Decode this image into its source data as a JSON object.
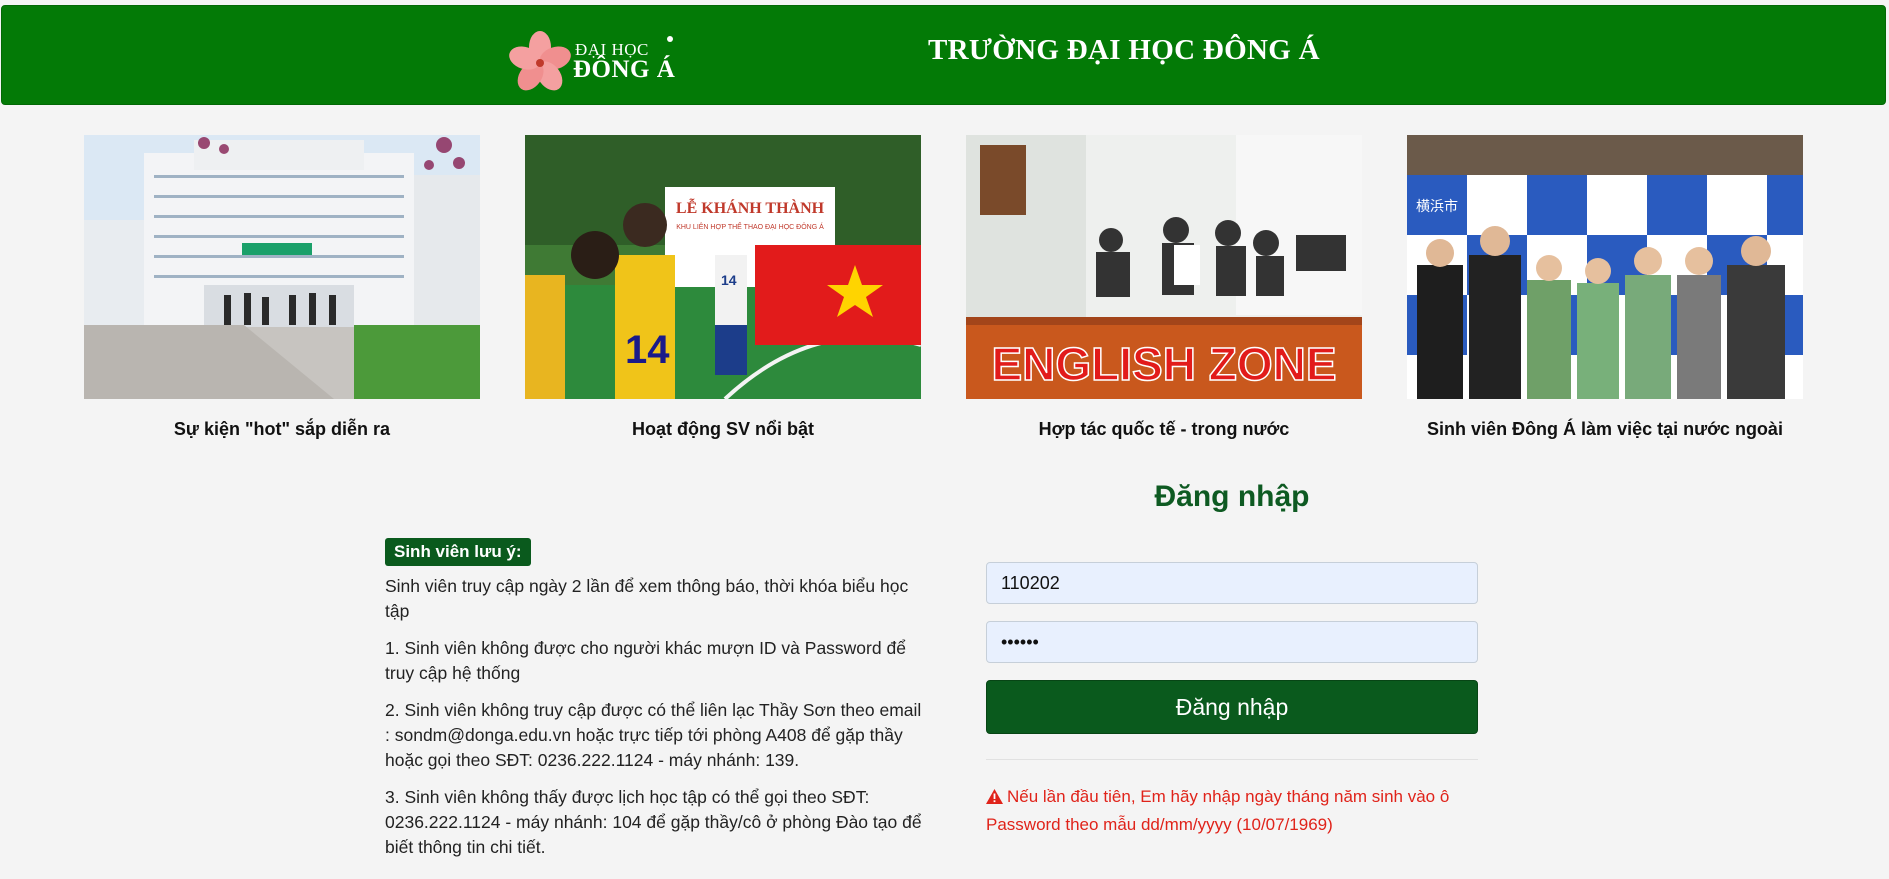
{
  "header": {
    "logo_top": "ĐẠI HỌC",
    "logo_main": "ĐÔNG Á",
    "title": "TRƯỜNG ĐẠI HỌC ĐÔNG Á"
  },
  "cards": [
    {
      "caption": "Sự kiện \"hot\" sắp diễn ra"
    },
    {
      "caption": "Hoạt động SV nổi bật",
      "banner_line1": "LỄ KHÁNH THÀNH",
      "banner_line2": "KHU LIÊN HỢP THỂ THAO ĐẠI HỌC ĐÔNG Á",
      "jersey_left": "14",
      "jersey_back": "14"
    },
    {
      "caption": "Hợp tác quốc tế - trong nước",
      "sign_text": "ENGLISH ZONE"
    },
    {
      "caption": "Sinh viên Đông Á làm việc tại nước ngoài",
      "backdrop_text": "横浜市"
    }
  ],
  "notice": {
    "badge": "Sinh viên lưu ý:",
    "items": [
      "Sinh viên truy cập ngày 2 lần để xem thông báo, thời khóa biểu học tập",
      "1. Sinh viên không được cho người khác mượn ID và Password để truy cập hệ thống",
      "2. Sinh viên không truy cập được có thể liên lạc Thầy Sơn theo email : sondm@donga.edu.vn hoặc trực tiếp tới phòng A408 để gặp thầy hoặc gọi theo SĐT: 0236.222.1124 - máy nhánh: 139.",
      "3. Sinh viên không thấy được lịch học tập có thể gọi theo SĐT: 0236.222.1124 - máy nhánh: 104 để gặp thầy/cô ở phòng Đào tạo để biết thông tin chi tiết."
    ]
  },
  "login": {
    "title": "Đăng nhập",
    "username_value": "110202",
    "password_value": "••••••",
    "button_label": "Đăng nhập",
    "warning": "Nếu lần đầu tiên, Em hãy nhập ngày tháng năm sinh vào ô Password theo mẫu dd/mm/yyyy (10/07/1969)"
  },
  "colors": {
    "header_green": "#037a06",
    "dark_green": "#0a5a1d",
    "warning_red": "#e0231a"
  }
}
